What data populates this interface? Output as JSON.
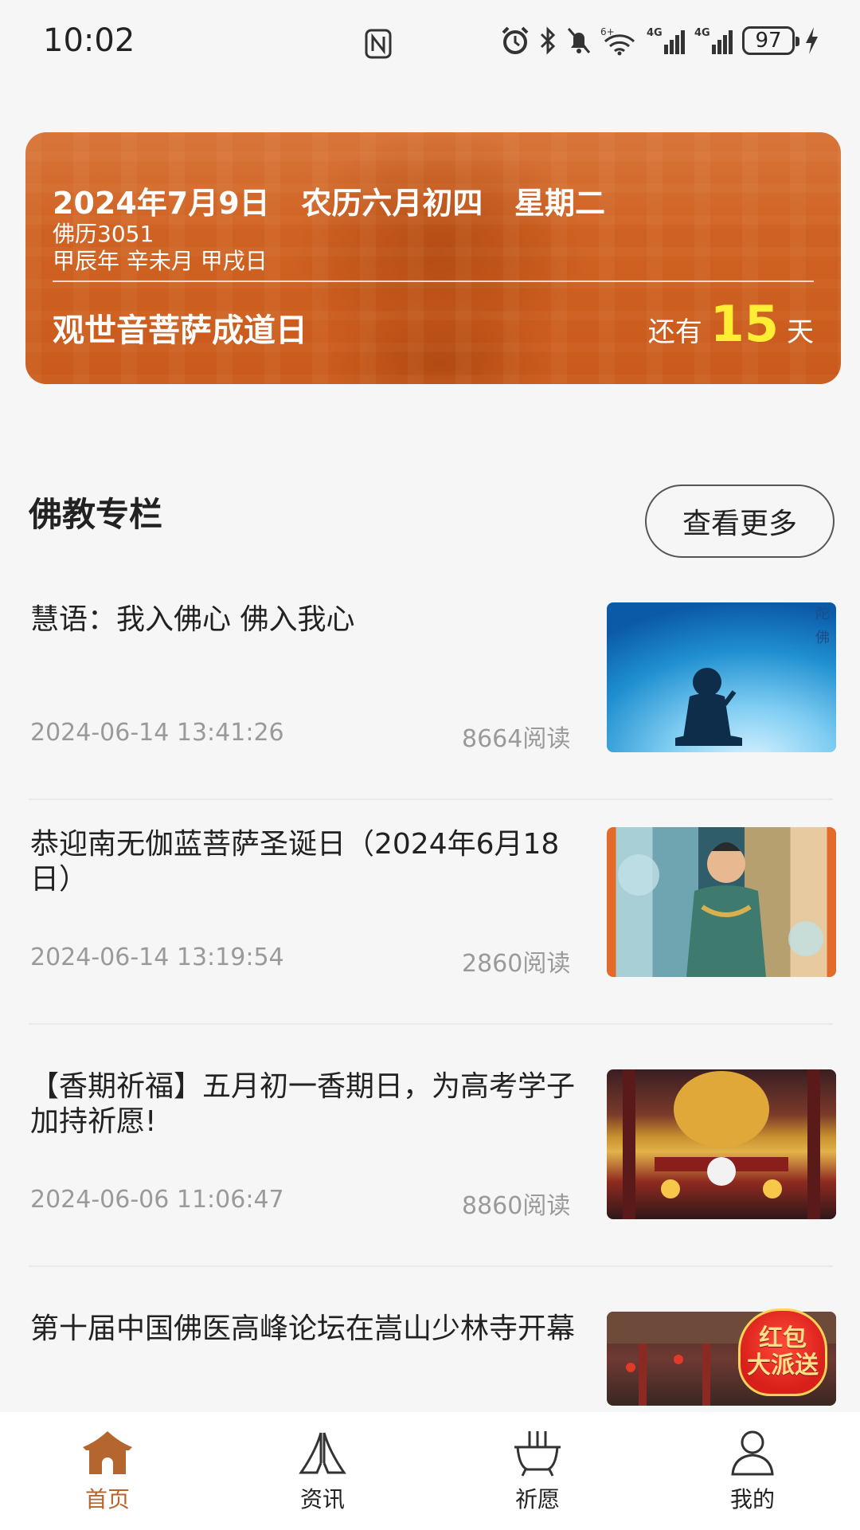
{
  "status_bar": {
    "time": "10:02",
    "battery": "97",
    "network_1": "4G",
    "network_2": "4G",
    "wifi_badge": "6+"
  },
  "banner": {
    "date_line": "2024年7月9日   农历六月初四   星期二",
    "buddhist_era": "佛历3051",
    "ganzhi": "甲辰年 辛未月 甲戌日",
    "event": "观世音菩萨成道日",
    "countdown_prefix": "还有",
    "countdown_days": "15",
    "countdown_suffix": "天",
    "accent_color": "#cf6222",
    "highlight_color": "#ffee33"
  },
  "section": {
    "title": "佛教专栏",
    "more_label": "查看更多"
  },
  "articles": [
    {
      "title": "慧语：我入佛心 佛入我心",
      "date": "2024-06-14 13:41:26",
      "reads": "8664阅读"
    },
    {
      "title": "恭迎南无伽蓝菩萨圣诞日（2024年6月18日）",
      "date": "2024-06-14 13:19:54",
      "reads": "2860阅读"
    },
    {
      "title": "【香期祈福】五月初一香期日，为高考学子加持祈愿!",
      "date": "2024-06-06 11:06:47",
      "reads": "8860阅读"
    },
    {
      "title": "第十届中国佛医高峰论坛在嵩山少林寺开幕",
      "date": "",
      "reads": ""
    }
  ],
  "promo": {
    "line1": "红包",
    "line2": "大派送"
  },
  "bottom_nav": {
    "items": [
      {
        "label": "首页",
        "icon": "temple-icon",
        "active": true
      },
      {
        "label": "资讯",
        "icon": "palms-icon",
        "active": false
      },
      {
        "label": "祈愿",
        "icon": "incense-burner-icon",
        "active": false
      },
      {
        "label": "我的",
        "icon": "user-icon",
        "active": false
      }
    ],
    "active_color": "#b5662f"
  }
}
